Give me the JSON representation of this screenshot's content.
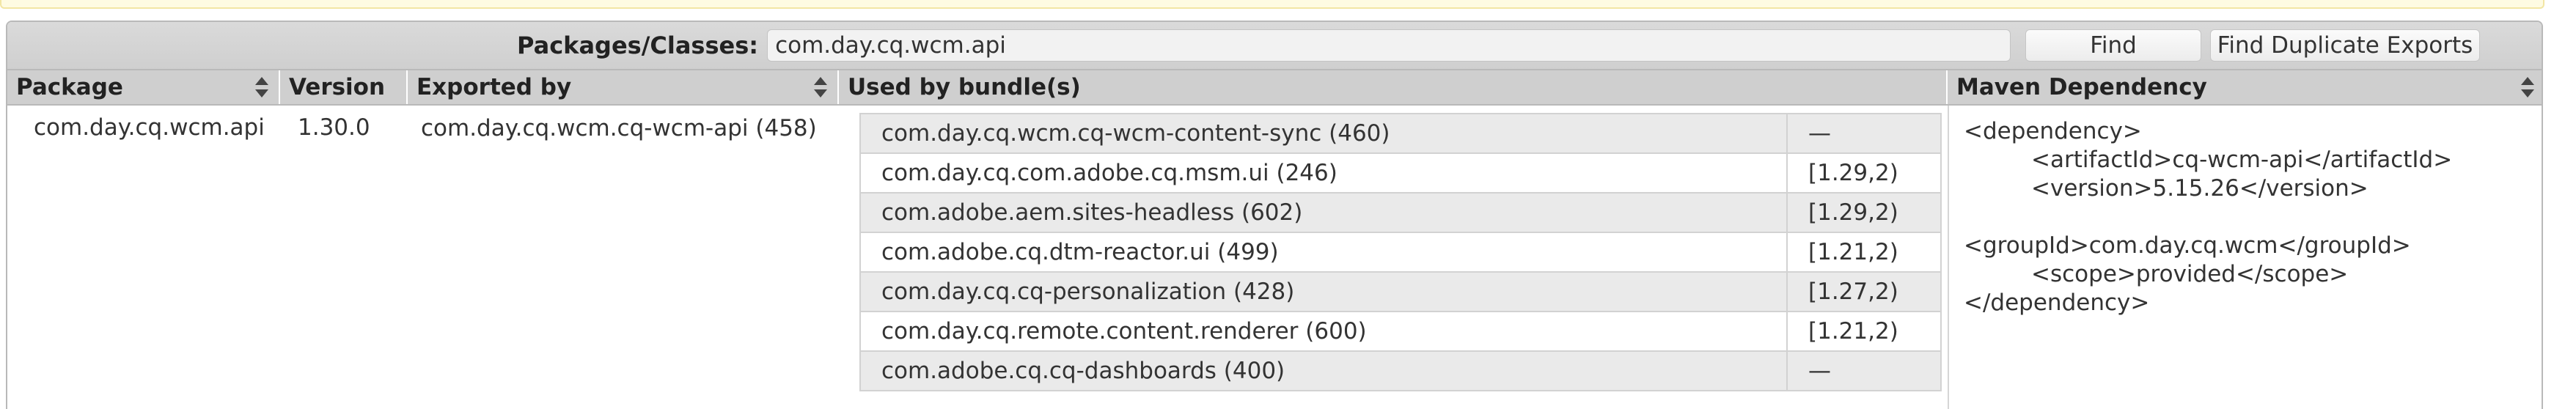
{
  "toolbar": {
    "search_label": "Packages/Classes:",
    "search_value": "com.day.cq.wcm.api",
    "find_label": "Find",
    "find_duplicates_label": "Find Duplicate Exports"
  },
  "columns": [
    {
      "label": "Package",
      "sortable": true
    },
    {
      "label": "Version",
      "sortable": false
    },
    {
      "label": "Exported by",
      "sortable": true
    },
    {
      "label": "Used by bundle(s)",
      "sortable": false
    },
    {
      "label": "Maven Dependency",
      "sortable": true
    }
  ],
  "row": {
    "package": "com.day.cq.wcm.api",
    "version": "1.30.0",
    "exported_by": "com.day.cq.wcm.cq-wcm-api (458)",
    "used_by": [
      {
        "bundle": "com.day.cq.wcm.cq-wcm-content-sync (460)",
        "range": "—"
      },
      {
        "bundle": "com.day.cq.com.adobe.cq.msm.ui (246)",
        "range": "[1.29,2)"
      },
      {
        "bundle": "com.adobe.aem.sites-headless (602)",
        "range": "[1.29,2)"
      },
      {
        "bundle": "com.adobe.cq.dtm-reactor.ui (499)",
        "range": "[1.21,2)"
      },
      {
        "bundle": "com.day.cq.cq-personalization (428)",
        "range": "[1.27,2)"
      },
      {
        "bundle": "com.day.cq.remote.content.renderer (600)",
        "range": "[1.21,2)"
      },
      {
        "bundle": "com.adobe.cq.cq-dashboards (400)",
        "range": "—"
      }
    ],
    "maven": {
      "open": "<dependency>",
      "artifact": "<artifactId>cq-wcm-api</artifactId>",
      "version": "<version>5.15.26</version>",
      "group": "<groupId>com.day.cq.wcm</groupId>",
      "scope": "<scope>provided</scope>",
      "close": "</dependency>"
    }
  },
  "colors": {
    "notice_bg": "#fefbe2",
    "header_bg": "#cfcfcf",
    "row_alt_bg": "#eaeaea"
  }
}
